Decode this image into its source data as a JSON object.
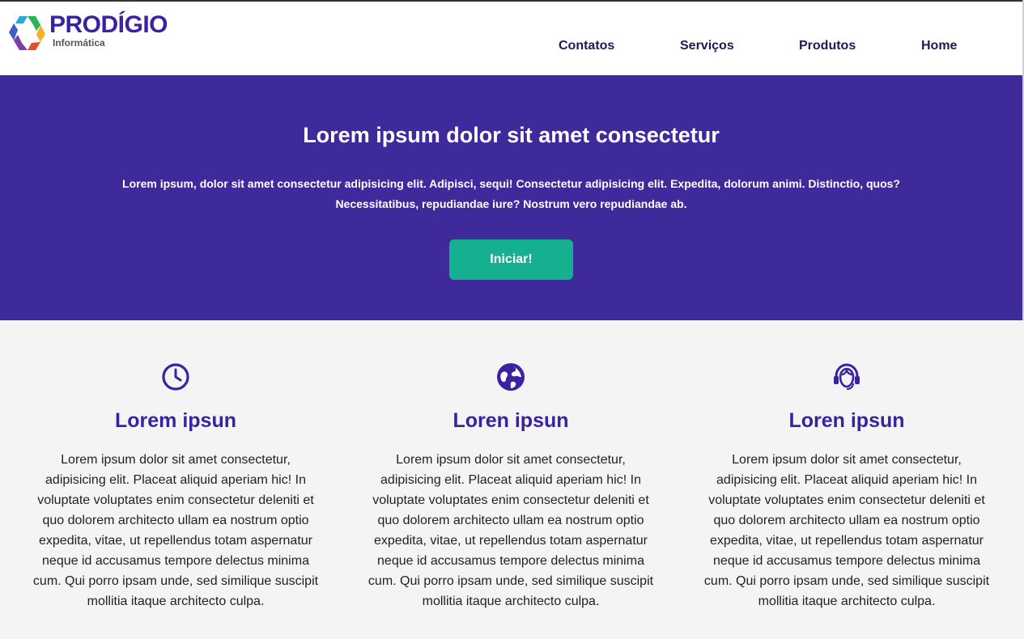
{
  "brand": {
    "name": "PRODÍGIO",
    "subtitle": "Informática",
    "colors": {
      "primary": "#3f2a9c",
      "accent": "#14b08f",
      "text_dark": "#1f1a55"
    }
  },
  "nav": {
    "items": [
      {
        "label": "Contatos"
      },
      {
        "label": "Serviços"
      },
      {
        "label": "Produtos"
      },
      {
        "label": "Home"
      }
    ]
  },
  "hero": {
    "title": "Lorem ipsum dolor sit amet consectetur",
    "text": "Lorem ipsum, dolor sit amet consectetur adipisicing elit. Adipisci, sequi! Consectetur adipisicing elit. Expedita, dolorum animi. Distinctio, quos? Necessitatibus, repudiandae iure? Nostrum vero repudiandae ab.",
    "button_label": "Iniciar!"
  },
  "features": [
    {
      "icon": "clock-icon",
      "title": "Lorem ipsun",
      "text": "Lorem ipsum dolor sit amet consectetur, adipisicing elit. Placeat aliquid aperiam hic! In voluptate voluptates enim consectetur deleniti et quo dolorem architecto ullam ea nostrum optio expedita, vitae, ut repellendus totam aspernatur neque id accusamus tempore delectus minima cum. Qui porro ipsam unde, sed similique suscipit mollitia itaque architecto culpa."
    },
    {
      "icon": "globe-icon",
      "title": "Loren ipsun",
      "text": "Lorem ipsum dolor sit amet consectetur, adipisicing elit. Placeat aliquid aperiam hic! In voluptate voluptates enim consectetur deleniti et quo dolorem architecto ullam ea nostrum optio expedita, vitae, ut repellendus totam aspernatur neque id accusamus tempore delectus minima cum. Qui porro ipsam unde, sed similique suscipit mollitia itaque architecto culpa."
    },
    {
      "icon": "headset-icon",
      "title": "Loren ipsun",
      "text": "Lorem ipsum dolor sit amet consectetur, adipisicing elit. Placeat aliquid aperiam hic! In voluptate voluptates enim consectetur deleniti et quo dolorem architecto ullam ea nostrum optio expedita, vitae, ut repellendus totam aspernatur neque id accusamus tempore delectus minima cum. Qui porro ipsam unde, sed similique suscipit mollitia itaque architecto culpa."
    }
  ]
}
